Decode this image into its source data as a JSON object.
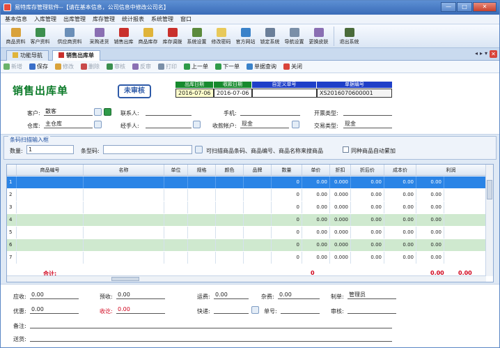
{
  "window": {
    "title": "易特库存管理软件--【请在基本信息，公司信息中修改公司名】",
    "min": "—",
    "max": "□",
    "close": "✕"
  },
  "menu": [
    "基本信息",
    "入库管理",
    "出库管理",
    "库存管理",
    "统计报表",
    "系统管理",
    "窗口"
  ],
  "toolbar": [
    {
      "label": "商品资料",
      "color": "#d9a23a"
    },
    {
      "label": "客户资料",
      "color": "#3d8f4e"
    },
    {
      "label": "供应商资料",
      "color": "#6b8fb8"
    },
    {
      "label": "采购进货",
      "color": "#8a6fb3"
    },
    {
      "label": "销售出库",
      "color": "#c9302c"
    },
    {
      "label": "商品库存",
      "color": "#e0b43a"
    },
    {
      "label": "库存调拨",
      "color": "#c9302c"
    },
    {
      "label": "系统设置",
      "color": "#5b8a3c"
    },
    {
      "label": "修改密码",
      "color": "#e8c95a"
    },
    {
      "label": "官方网站",
      "color": "#3a82c9"
    },
    {
      "label": "锁定系统",
      "color": "#6b7f99"
    },
    {
      "label": "导航设置",
      "color": "#7a8fa8"
    },
    {
      "label": "更换皮肤",
      "color": "#8a6fb3"
    },
    {
      "label": "退出系统",
      "color": "#4a6b3a"
    }
  ],
  "tabs": [
    {
      "label": "功能导航",
      "color": "#e0b43a"
    },
    {
      "label": "销售出库单",
      "color": "#c9302c"
    }
  ],
  "tabctl": {
    "prev": "◂",
    "next": "▸",
    "pin": "▾",
    "close": "✕"
  },
  "subtoolbar": [
    {
      "label": "新增",
      "enabled": false,
      "color": "#6bb36b"
    },
    {
      "label": "保存",
      "enabled": true,
      "color": "#3a6fc9"
    },
    {
      "label": "修改",
      "enabled": false,
      "color": "#d9a23a"
    },
    {
      "label": "删除",
      "enabled": false,
      "color": "#c94a4a"
    },
    {
      "label": "审核",
      "enabled": false,
      "color": "#3a8f4e"
    },
    {
      "label": "反审",
      "enabled": false,
      "color": "#8a6fb3"
    },
    {
      "label": "打印",
      "enabled": false,
      "color": "#7a8fa8"
    },
    {
      "label": "上一单",
      "enabled": true,
      "color": "#2f9b49"
    },
    {
      "label": "下一单",
      "enabled": true,
      "color": "#2f9b49"
    },
    {
      "label": "单据查询",
      "enabled": true,
      "color": "#3a82c9"
    },
    {
      "label": "关闭",
      "enabled": true,
      "color": "#d9443a"
    }
  ],
  "form": {
    "title": "销售出库单",
    "status": "未审核",
    "hdr": {
      "out_date": "出库日期",
      "ship_date": "收款日期",
      "custom_no": "自定义单号",
      "doc_no": "单据编号"
    },
    "val": {
      "out_date": "2016-07-06",
      "ship_date": "2016-07-06",
      "custom_no": "",
      "doc_no": "XS2016070600001"
    },
    "customer_label": "客户:",
    "customer": "散客",
    "contact_label": "联系人:",
    "contact": "",
    "phone_label": "手机:",
    "phone": "",
    "invoice_label": "开票类型:",
    "invoice": "",
    "warehouse_label": "仓库:",
    "warehouse": "主仓库",
    "handler_label": "经手人:",
    "handler": "",
    "account_label": "收款帐户:",
    "account": "现金",
    "trade_label": "交易类型:",
    "trade": "现金"
  },
  "scan": {
    "legend": "条码扫描输入框",
    "qty_label": "数量:",
    "qty": "1",
    "barcode_label": "条型码:",
    "barcode": "",
    "hint": "可扫描商品条码、商品编号、商品名称来搜商品",
    "merge_label": "同种商品自动累加"
  },
  "grid": {
    "cols": [
      "",
      "商品编号",
      "名称",
      "单位",
      "规格",
      "颜色",
      "品牌",
      "数量",
      "单价",
      "折扣",
      "折后价",
      "成本价",
      "利润"
    ],
    "rows": [
      {
        "n": "1",
        "qty": "0",
        "price": "0.00",
        "disc": "0.000",
        "after": "0.00",
        "cost": "0.00",
        "profit": "0.00"
      },
      {
        "n": "2",
        "qty": "0",
        "price": "0.00",
        "disc": "0.000",
        "after": "0.00",
        "cost": "0.00",
        "profit": "0.00"
      },
      {
        "n": "3",
        "qty": "0",
        "price": "0.00",
        "disc": "0.000",
        "after": "0.00",
        "cost": "0.00",
        "profit": "0.00"
      },
      {
        "n": "4",
        "qty": "0",
        "price": "0.00",
        "disc": "0.000",
        "after": "0.00",
        "cost": "0.00",
        "profit": "0.00"
      },
      {
        "n": "5",
        "qty": "0",
        "price": "0.00",
        "disc": "0.000",
        "after": "0.00",
        "cost": "0.00",
        "profit": "0.00"
      },
      {
        "n": "6",
        "qty": "0",
        "price": "0.00",
        "disc": "0.000",
        "after": "0.00",
        "cost": "0.00",
        "profit": "0.00"
      },
      {
        "n": "7",
        "qty": "0",
        "price": "0.00",
        "disc": "0.000",
        "after": "0.00",
        "cost": "0.00",
        "profit": "0.00"
      }
    ],
    "total_label": "合计:",
    "total_qty": "0",
    "total_cost": "0.00",
    "total_profit": "0.00"
  },
  "footer": {
    "receivable_label": "应收:",
    "receivable": "0.00",
    "prepaid_label": "预收:",
    "prepaid": "0.00",
    "freight_label": "运费:",
    "freight": "0.00",
    "misc_label": "杂费:",
    "misc": "0.00",
    "maker_label": "制单:",
    "maker": "管理员",
    "discount_label": "优惠:",
    "discount": "0.00",
    "received_label": "收讫:",
    "received": "0.00",
    "express_label": "快递:",
    "express": "",
    "tracking_label": "单号:",
    "tracking": "",
    "auditor_label": "审核:",
    "auditor": "",
    "note_label": "备注:",
    "note": "",
    "address_label": "送货:",
    "address": ""
  }
}
